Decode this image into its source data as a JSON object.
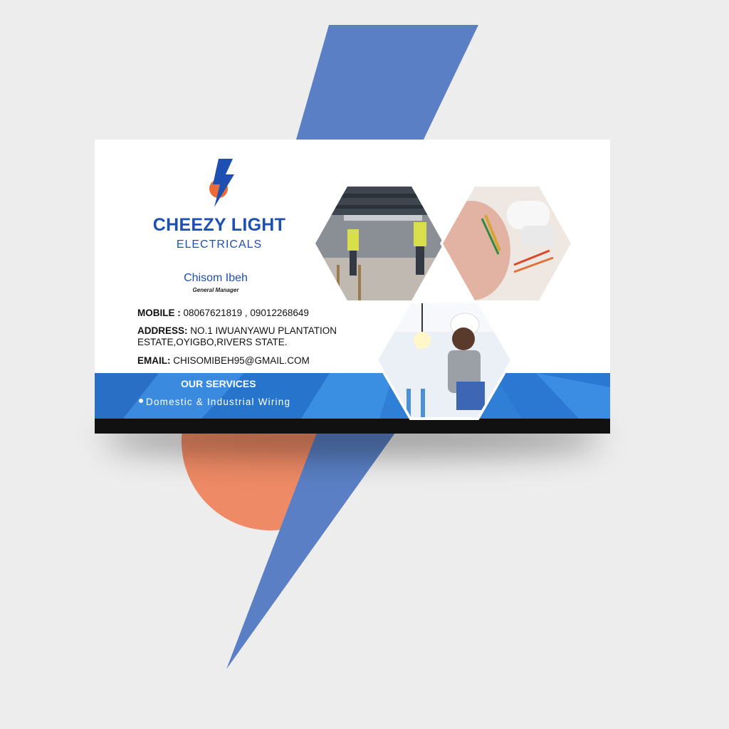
{
  "brand": {
    "name": "CHEEZY LIGHT",
    "subtitle": "ELECTRICALS"
  },
  "person": {
    "name": "Chisom Ibeh",
    "title": "General Manager"
  },
  "contact": {
    "mobile_label": "MOBILE :",
    "mobile_value": "08067621819 , 09012268649",
    "address_label": "ADDRESS:",
    "address_value": "NO.1 IWUANYAWU PLANTATION ESTATE,OYIGBO,RIVERS STATE.",
    "email_label": "EMAIL:",
    "email_value": "CHISOMIBEH95@GMAIL.COM"
  },
  "services": {
    "title": "OUR SERVICES",
    "item": "Domestic & Industrial Wiring"
  },
  "colors": {
    "brand_blue": "#1e4fb3",
    "bolt_blue": "#5a7fc4",
    "accent_orange": "#ee8a65",
    "band_blue": "#2f7fd6",
    "base_black": "#111111"
  },
  "icons": {
    "logo": "lightning-bolt-icon",
    "bullet": "bullet-dot-icon"
  }
}
